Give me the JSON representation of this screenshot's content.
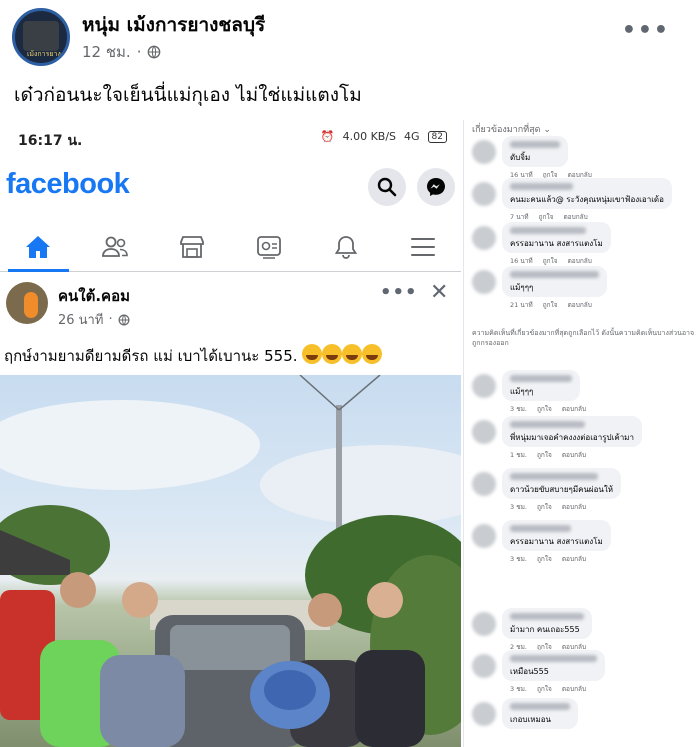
{
  "post": {
    "page_name": "หนุ่ม เม้งการยางชลบุรี",
    "time": "12 ชม.",
    "more": "•••",
    "caption": "เด๋วก่อนนะใจเย็นนี่แม่กุเอง ไม่ใช่แม่แตงโม",
    "avatar_text": "เม้งการยาง"
  },
  "screenshot": {
    "status_time": "16:17 น.",
    "status_speed": "4.00 KB/S",
    "status_signal": "4G",
    "battery": "82",
    "logo": "facebook",
    "nav_icons": [
      "home-icon",
      "friends-icon",
      "marketplace-icon",
      "watch-icon",
      "bell-icon",
      "menu-icon"
    ],
    "author": "คนใต้.คอม",
    "time": "26 นาที",
    "caption": "ฤกษ์งามยามดียามดีรถ แม่ เบาได้เบานะ 555.",
    "dots": "•••",
    "close": "✕"
  },
  "comments": {
    "header": "เกี่ยวข้องมากที่สุด ⌄",
    "note": "ความคิดเห็นที่เกี่ยวข้องมากที่สุดถูกเลือกไว้ ดังนั้นความคิดเห็นบางส่วนอาจถูกกรองออก",
    "like": "ถูกใจ",
    "reply": "ตอบกลับ",
    "items": [
      {
        "text": "ดับจิ้ม",
        "time": "16 นาที"
      },
      {
        "text": "คนมะคนแล้ว@ ระวังคุณหนุ่มเขาฟ้องเอาเด้อ",
        "time": "7 นาที"
      },
      {
        "text": "ครรอมานาน สงสารแตงโม",
        "time": "16 นาที"
      },
      {
        "text": "แม้ๆๆๆ",
        "time": "21 นาที"
      },
      {
        "text": "แม้ๆๆๆ",
        "time": "3 ชม."
      },
      {
        "text": "พี่หนุ่มมาเจอคำคงงงต่อเอารูปเค้ามา",
        "time": "1 ชม."
      },
      {
        "text": "ดาวน้วยขับสบายๆมีคนผ่อนให้",
        "time": "3 ชม."
      },
      {
        "text": "ครรอมานาน สงสารแตงโม",
        "time": "3 ชม."
      },
      {
        "text": "ม้ามาก คนเถอะ555",
        "time": "2 ชม."
      },
      {
        "text": "เหมือน555",
        "time": "3 ชม."
      },
      {
        "text": "เกอบเหมอน",
        "time": ""
      }
    ]
  }
}
